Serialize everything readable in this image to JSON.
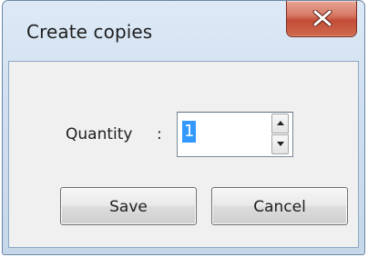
{
  "window": {
    "title": "Create copies",
    "close_icon": "close-x-icon"
  },
  "form": {
    "quantity_label": "Quantity",
    "quantity_colon": ":",
    "quantity_value": "1",
    "spin_up_icon": "triangle-up-icon",
    "spin_down_icon": "triangle-down-icon"
  },
  "buttons": {
    "save_label": "Save",
    "cancel_label": "Cancel"
  },
  "colors": {
    "close_button": "#c7503a",
    "selection": "#3399ff",
    "frame": "#d2e1f1",
    "client": "#f0f0f0"
  }
}
